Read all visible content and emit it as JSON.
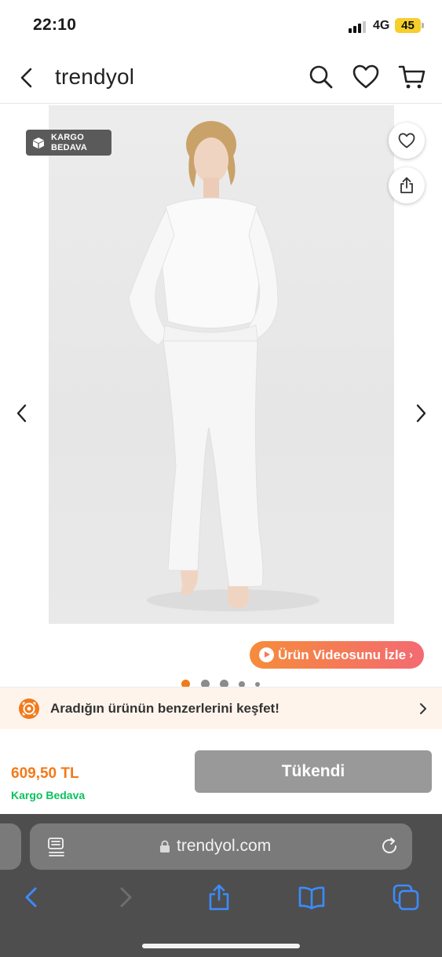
{
  "status_bar": {
    "time": "22:10",
    "network": "4G",
    "battery": "45"
  },
  "header": {
    "logo": "trendyol",
    "icons": [
      "back-arrow",
      "search",
      "heart",
      "cart"
    ]
  },
  "gallery": {
    "badge_line1": "KARGO",
    "badge_line2": "BEDAVA",
    "video_button": "Ürün Videosunu İzle",
    "page_count": 5,
    "active_page": 1
  },
  "discover": {
    "text": "Aradığın ürünün benzerlerini keşfet!"
  },
  "purchase": {
    "price": "609,50 TL",
    "shipping": "Kargo Bedava",
    "button": "Tükendi"
  },
  "browser": {
    "url": "trendyol.com"
  },
  "colors": {
    "brand_orange": "#f27a1a",
    "shipping_green": "#0bc15c",
    "disabled_button": "#999999",
    "safari_bar": "#4e4e4e"
  }
}
